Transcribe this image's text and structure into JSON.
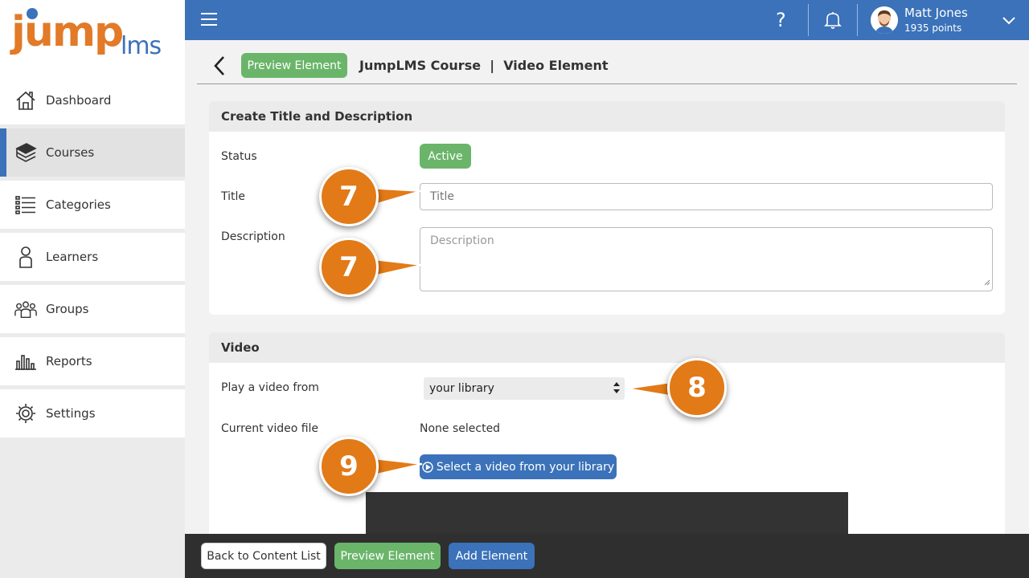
{
  "logo": {
    "jump": "jump",
    "lms": "lms"
  },
  "sidebar": {
    "items": [
      {
        "label": "Dashboard",
        "icon": "home-icon"
      },
      {
        "label": "Courses",
        "icon": "books-icon",
        "active": true
      },
      {
        "label": "Categories",
        "icon": "list-icon"
      },
      {
        "label": "Learners",
        "icon": "person-icon"
      },
      {
        "label": "Groups",
        "icon": "group-icon"
      },
      {
        "label": "Reports",
        "icon": "chart-icon"
      },
      {
        "label": "Settings",
        "icon": "gear-icon"
      }
    ]
  },
  "topbar": {
    "help_glyph": "?",
    "user_name": "Matt Jones",
    "user_points": "1935 points"
  },
  "header": {
    "preview_label": "Preview Element",
    "title": "JumpLMS Course  |  Video Element"
  },
  "title_panel": {
    "heading": "Create Title and Description",
    "status_label": "Status",
    "status_value": "Active",
    "title_label": "Title",
    "title_placeholder": "Title",
    "description_label": "Description",
    "description_placeholder": "Description"
  },
  "video_panel": {
    "heading": "Video",
    "play_from_label": "Play a video from",
    "play_from_value": "your library",
    "current_file_label": "Current video file",
    "current_file_value": "None selected",
    "select_button_label": "Select a video from your library"
  },
  "bottombar": {
    "back_label": "Back to Content List",
    "preview_label": "Preview Element",
    "add_label": "Add Element"
  },
  "callouts": {
    "c1": "7",
    "c2": "7",
    "c3": "8",
    "c4": "9"
  },
  "colors": {
    "brand_blue": "#3b72b9",
    "brand_orange": "#e27a27",
    "green": "#6ab56a",
    "callout": "#e27a17"
  }
}
